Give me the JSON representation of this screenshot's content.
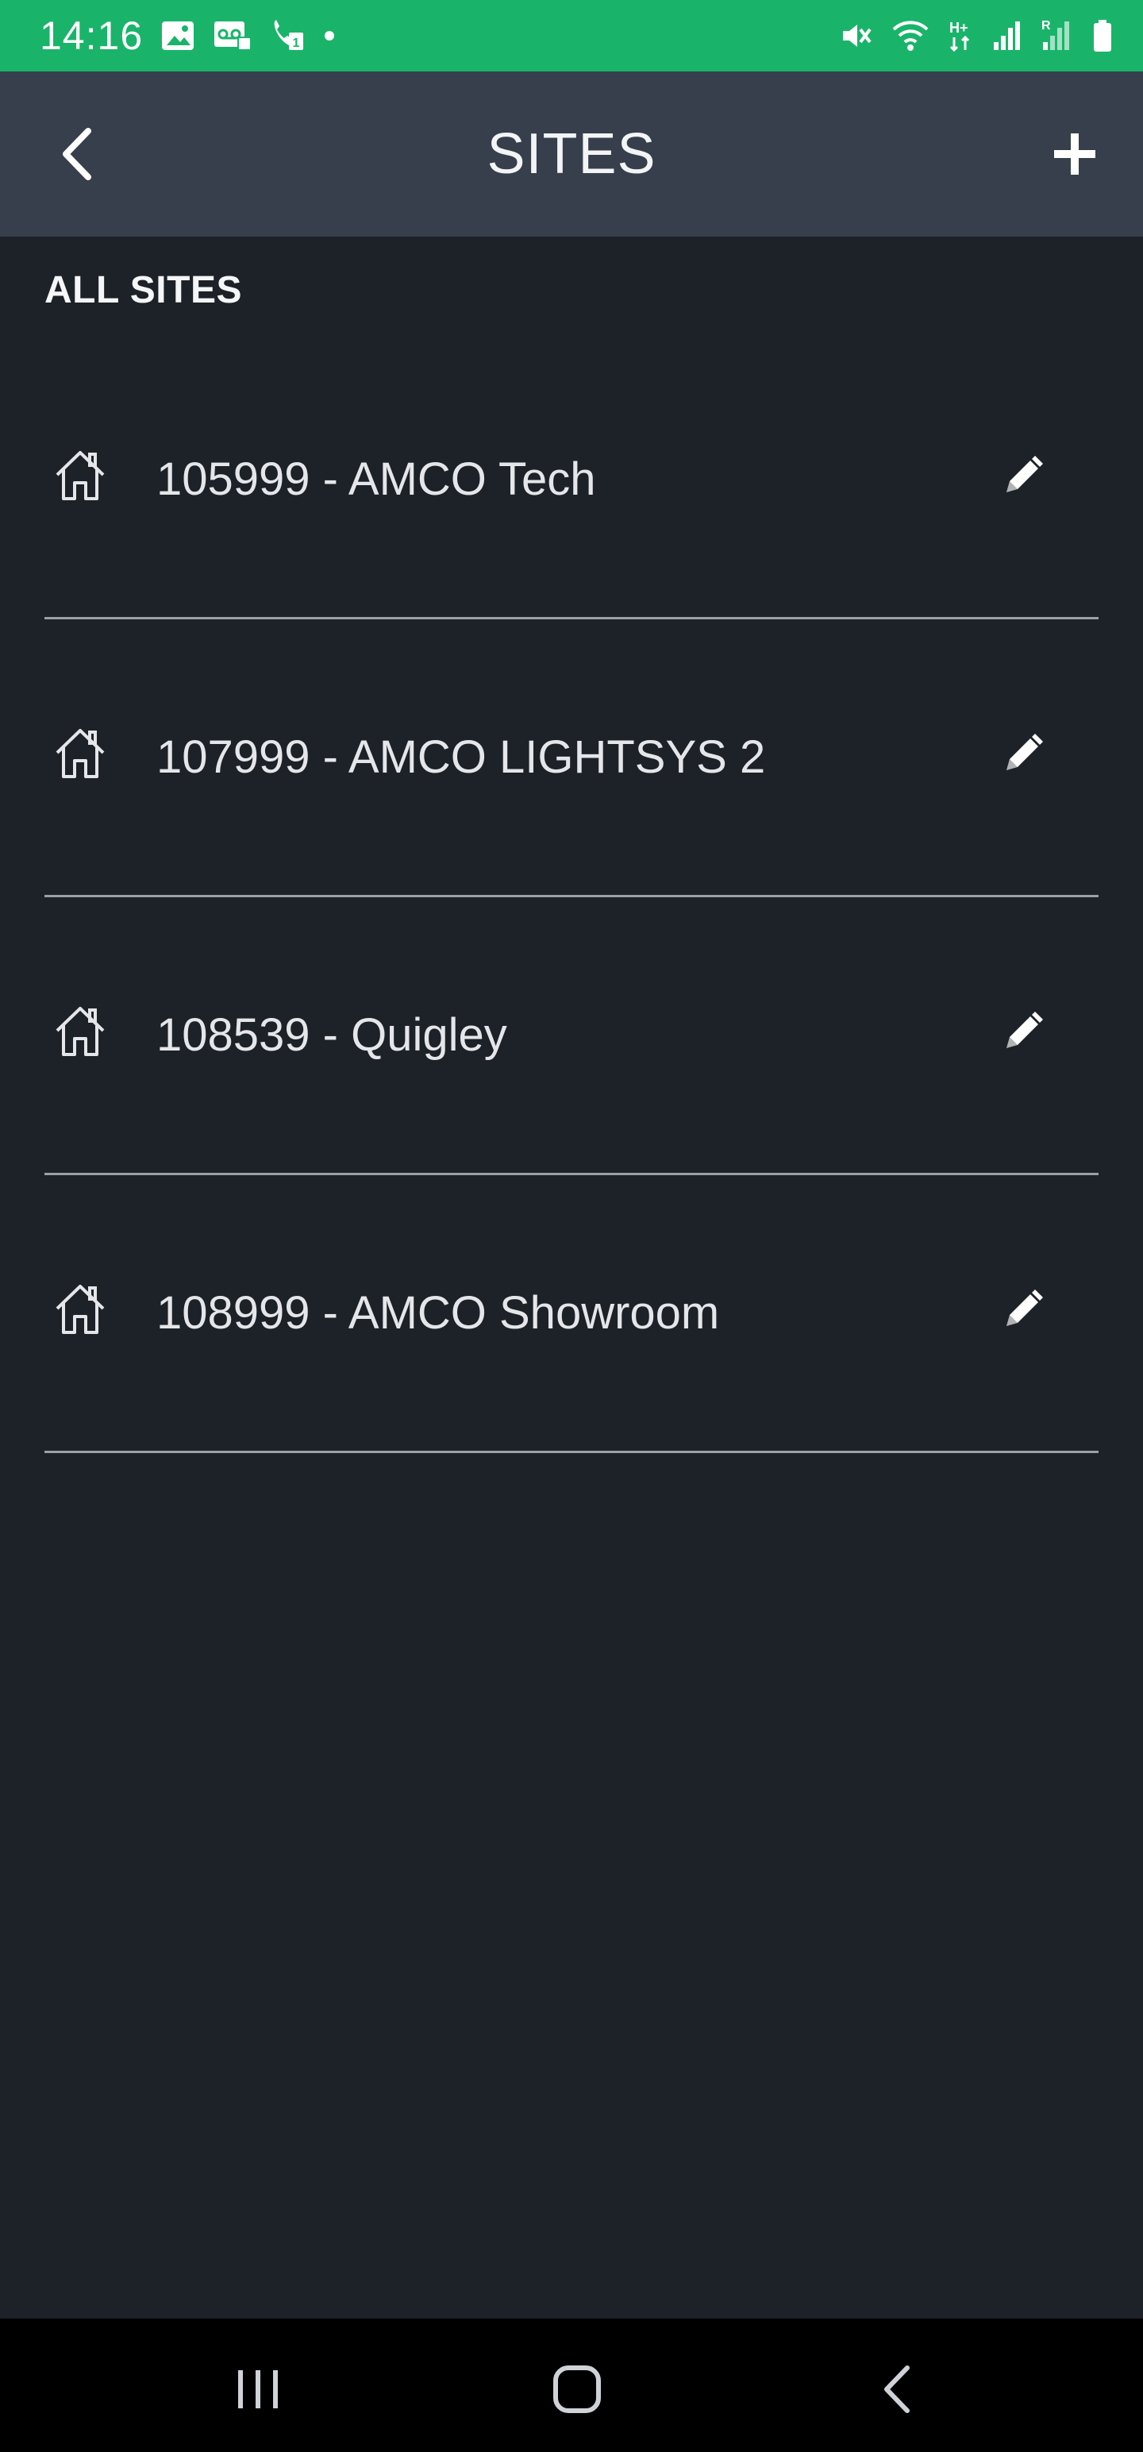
{
  "status_bar": {
    "time": "14:16",
    "left_icons": [
      "gallery-icon",
      "voicemail-icon",
      "call-icon",
      "dot-icon"
    ],
    "right_icons": [
      "mute-icon",
      "wifi-icon",
      "data-h-plus-icon",
      "signal-icon",
      "signal-roaming-icon",
      "battery-icon"
    ],
    "roaming_label": "R",
    "data_label": "H+"
  },
  "header": {
    "title": "SITES",
    "back_icon": "chevron-left-icon",
    "add_icon": "plus-icon"
  },
  "section": {
    "heading": "ALL SITES"
  },
  "sites": [
    {
      "label": "105999 - AMCO Tech",
      "icon": "home-icon",
      "action_icon": "pencil-icon"
    },
    {
      "label": "107999 - AMCO LIGHTSYS 2",
      "icon": "home-icon",
      "action_icon": "pencil-icon"
    },
    {
      "label": "108539 - Quigley",
      "icon": "home-icon",
      "action_icon": "pencil-icon"
    },
    {
      "label": "108999 - AMCO Showroom",
      "icon": "home-icon",
      "action_icon": "pencil-icon"
    }
  ],
  "nav_bar": {
    "buttons": [
      "recents-icon",
      "home-nav-icon",
      "back-nav-icon"
    ]
  },
  "colors": {
    "status_bar": "#19b46a",
    "header": "#363f4b",
    "background": "#1d2128",
    "divider": "#9aa0a8",
    "nav_bar": "#000000"
  }
}
